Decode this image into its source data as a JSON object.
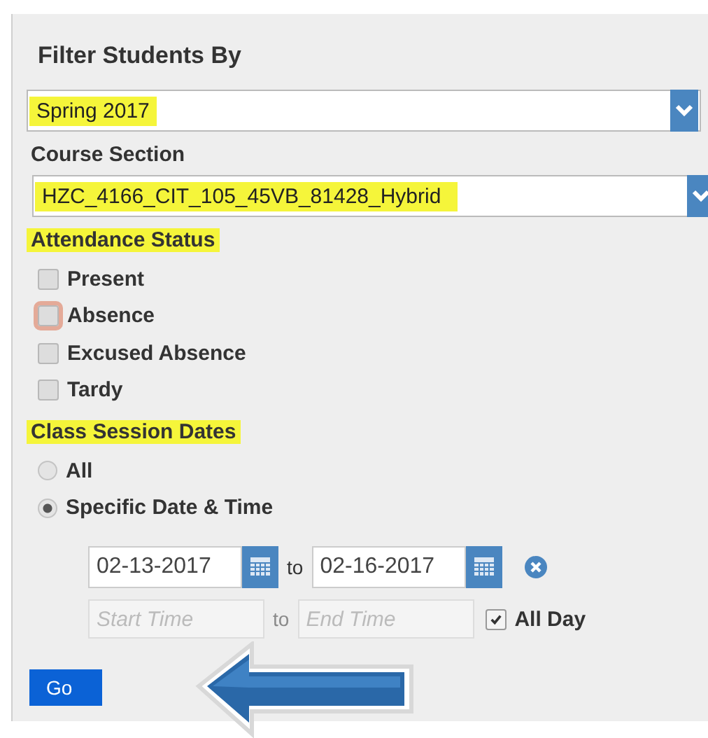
{
  "panel": {
    "title": "Filter Students By"
  },
  "term_select": {
    "value": "Spring 2017",
    "highlighted": true
  },
  "course_section": {
    "label": "Course Section",
    "highlighted": false,
    "value": "HZC_4166_CIT_105_45VB_81428_Hybrid",
    "value_highlighted": true
  },
  "attendance_status": {
    "label": "Attendance Status",
    "highlighted": true,
    "options": [
      {
        "label": "Present",
        "checked": false,
        "focused": false
      },
      {
        "label": "Absence",
        "checked": false,
        "focused": true
      },
      {
        "label": "Excused Absence",
        "checked": false,
        "focused": false
      },
      {
        "label": "Tardy",
        "checked": false,
        "focused": false
      }
    ]
  },
  "class_session_dates": {
    "label": "Class Session Dates",
    "highlighted": true,
    "options": [
      {
        "label": "All",
        "selected": false
      },
      {
        "label": "Specific Date & Time",
        "selected": true
      }
    ],
    "start_date": "02-13-2017",
    "date_separator": "to",
    "end_date": "02-16-2017",
    "start_time": {
      "placeholder": "Start Time"
    },
    "time_separator": "to",
    "end_time": {
      "placeholder": "End Time"
    },
    "all_day": {
      "label": "All Day",
      "checked": true
    }
  },
  "go_button": "Go",
  "annotation": {
    "kind": "arrow"
  }
}
